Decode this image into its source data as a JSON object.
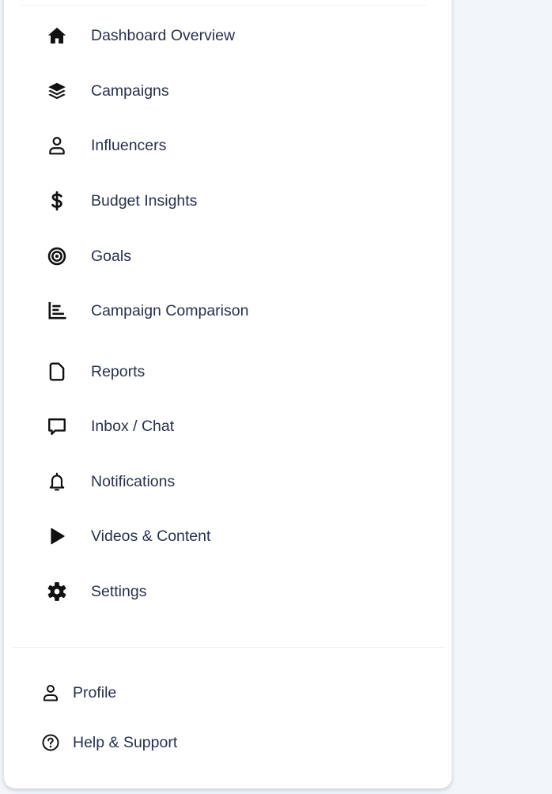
{
  "sidebar": {
    "items": [
      {
        "label": "Dashboard Overview",
        "icon": "home-icon"
      },
      {
        "label": "Campaigns",
        "icon": "layers-icon"
      },
      {
        "label": "Influencers",
        "icon": "user-icon"
      },
      {
        "label": "Budget Insights",
        "icon": "dollar-icon"
      },
      {
        "label": "Goals",
        "icon": "target-icon"
      },
      {
        "label": "Campaign Comparison",
        "icon": "bar-chart-icon"
      },
      {
        "label": "Reports",
        "icon": "file-icon"
      },
      {
        "label": "Inbox / Chat",
        "icon": "chat-icon"
      },
      {
        "label": "Notifications",
        "icon": "bell-icon"
      },
      {
        "label": "Videos & Content",
        "icon": "play-icon"
      },
      {
        "label": "Settings",
        "icon": "gear-icon"
      }
    ],
    "footer": [
      {
        "label": "Profile",
        "icon": "user-icon"
      },
      {
        "label": "Help & Support",
        "icon": "help-circle-icon"
      }
    ]
  },
  "colors": {
    "page_background": "#f1f6fb",
    "sidebar_background": "#ffffff",
    "text": "#27314a",
    "icon": "#111111",
    "divider": "#eceff3"
  }
}
